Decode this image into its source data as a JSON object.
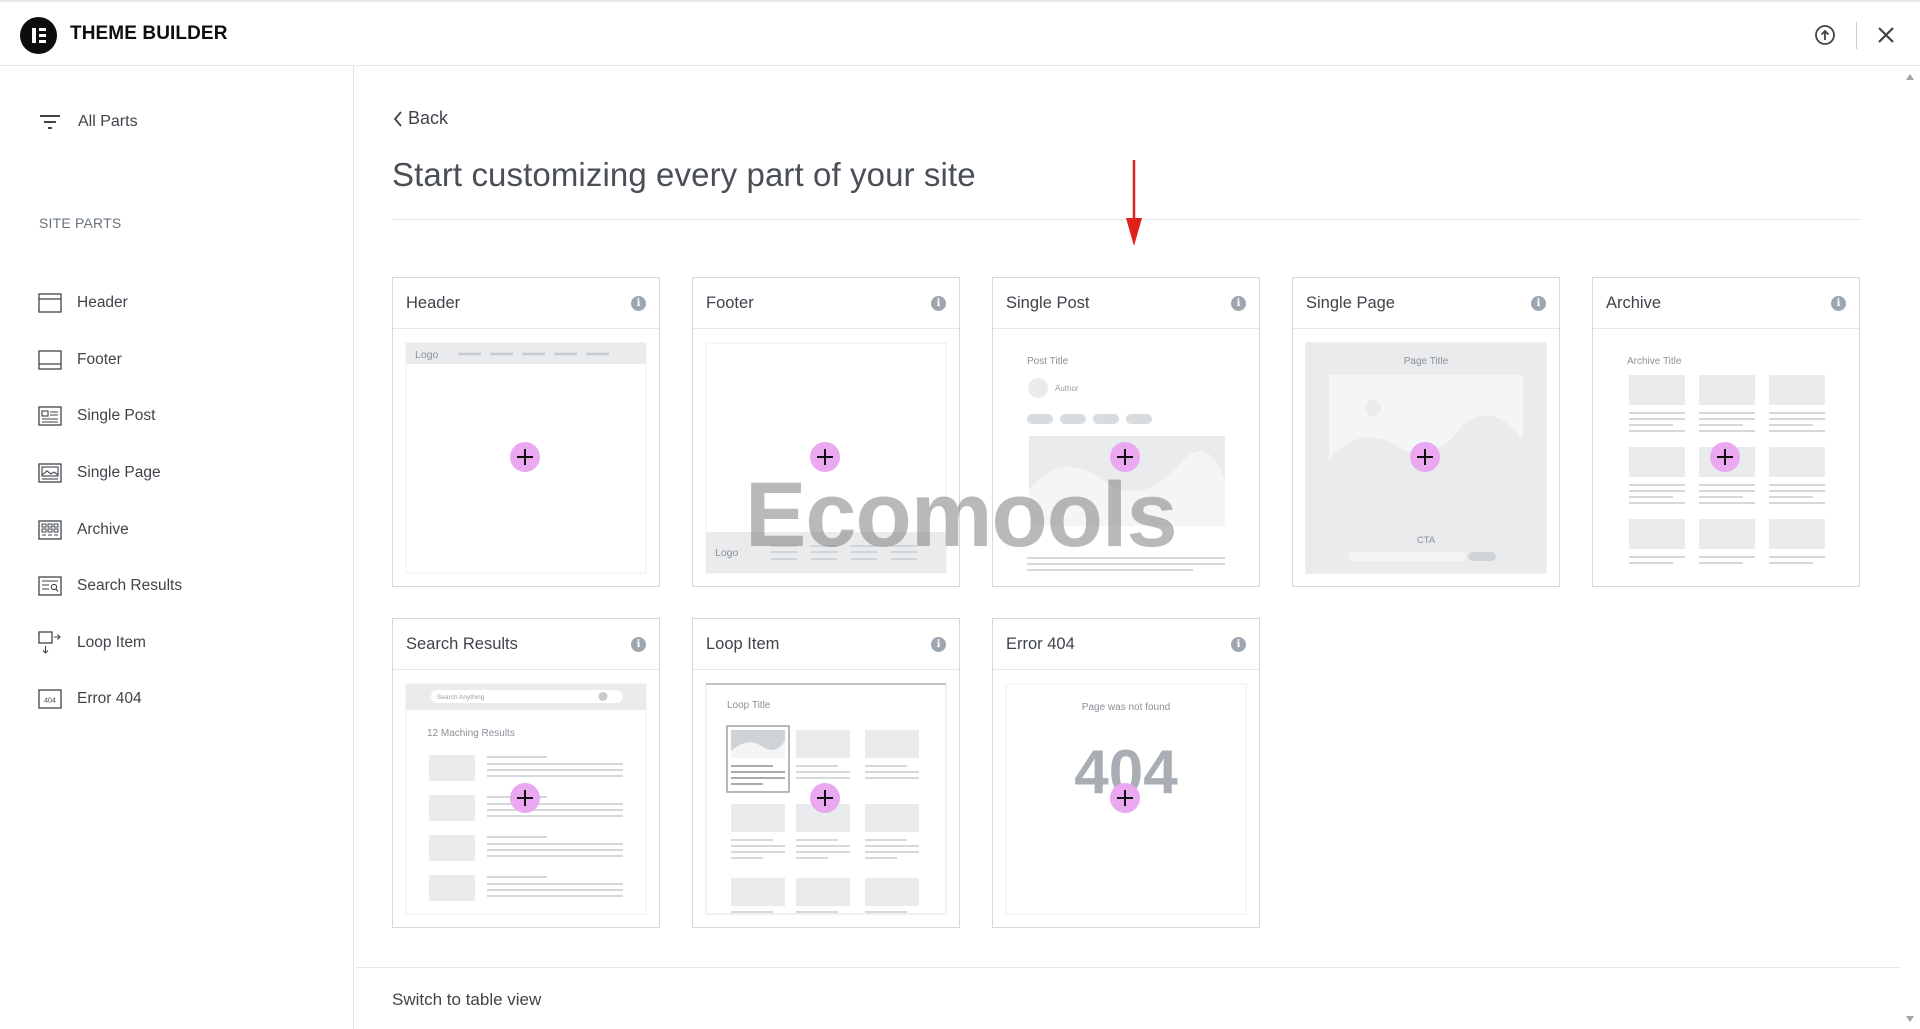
{
  "app": {
    "title": "THEME BUILDER"
  },
  "sidebar": {
    "all_parts": "All Parts",
    "section_title": "SITE PARTS",
    "items": [
      {
        "label": "Header",
        "icon": "header-layout-icon"
      },
      {
        "label": "Footer",
        "icon": "footer-layout-icon"
      },
      {
        "label": "Single Post",
        "icon": "single-post-icon"
      },
      {
        "label": "Single Page",
        "icon": "single-page-icon"
      },
      {
        "label": "Archive",
        "icon": "archive-grid-icon"
      },
      {
        "label": "Search Results",
        "icon": "search-results-icon"
      },
      {
        "label": "Loop Item",
        "icon": "loop-item-icon"
      },
      {
        "label": "Error 404",
        "icon": "error-404-icon"
      }
    ]
  },
  "main": {
    "back": "Back",
    "heading": "Start customizing every part of your site",
    "switch_view": "Switch to table view"
  },
  "cards": [
    {
      "title": "Header",
      "preview": {
        "logo": "Logo"
      }
    },
    {
      "title": "Footer",
      "preview": {
        "logo": "Logo"
      }
    },
    {
      "title": "Single Post",
      "preview": {
        "post_title": "Post Title",
        "author": "Author"
      }
    },
    {
      "title": "Single Page",
      "preview": {
        "page_title": "Page Title",
        "cta": "CTA"
      }
    },
    {
      "title": "Archive",
      "preview": {
        "archive_title": "Archive Title"
      }
    },
    {
      "title": "Search Results",
      "preview": {
        "search_placeholder": "Search Anything",
        "results": "12 Maching Results"
      }
    },
    {
      "title": "Loop Item",
      "preview": {
        "loop_title": "Loop Title"
      }
    },
    {
      "title": "Error 404",
      "preview": {
        "message": "Page was not found",
        "code": "404"
      }
    }
  ],
  "watermark": "Ecomools",
  "colors": {
    "accent_plus": "#e9a8f0",
    "arrow": "#e0201b",
    "text": "#3f444b"
  }
}
